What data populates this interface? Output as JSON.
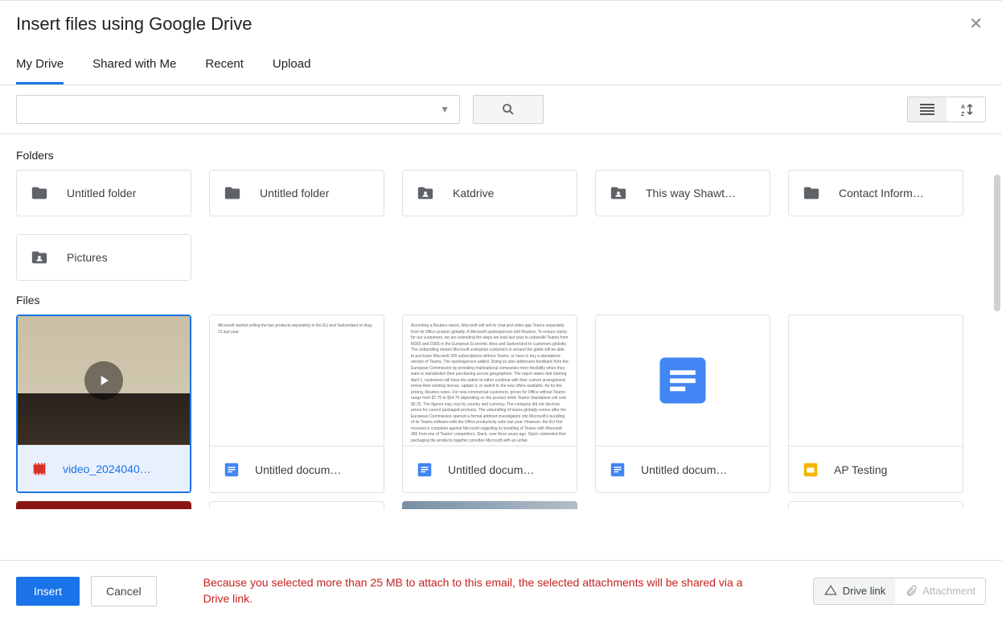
{
  "dialog": {
    "title": "Insert files using Google Drive"
  },
  "tabs": [
    {
      "label": "My Drive",
      "active": true
    },
    {
      "label": "Shared with Me"
    },
    {
      "label": "Recent"
    },
    {
      "label": "Upload"
    }
  ],
  "search": {
    "value": "",
    "placeholder": ""
  },
  "sections": {
    "folders_label": "Folders",
    "files_label": "Files"
  },
  "folders": [
    {
      "name": "Untitled folder",
      "icon": "folder"
    },
    {
      "name": "Untitled folder",
      "icon": "folder"
    },
    {
      "name": "Katdrive",
      "icon": "shared-folder"
    },
    {
      "name": "This way Shawt…",
      "icon": "shared-folder"
    },
    {
      "name": "Contact Inform…",
      "icon": "folder"
    },
    {
      "name": "Pictures",
      "icon": "shared-folder"
    }
  ],
  "files": [
    {
      "name": "video_2024040…",
      "filetype": "video",
      "selected": true
    },
    {
      "name": "Untitled docum…",
      "filetype": "doc"
    },
    {
      "name": "Untitled docum…",
      "filetype": "doc"
    },
    {
      "name": "Untitled docum…",
      "filetype": "doc"
    },
    {
      "name": "AP Testing",
      "filetype": "slides"
    }
  ],
  "footer": {
    "insert": "Insert",
    "cancel": "Cancel",
    "warning": "Because you selected more than 25 MB to attach to this email, the selected attachments will be shared via a Drive link.",
    "drive_link": "Drive link",
    "attachment": "Attachment"
  }
}
